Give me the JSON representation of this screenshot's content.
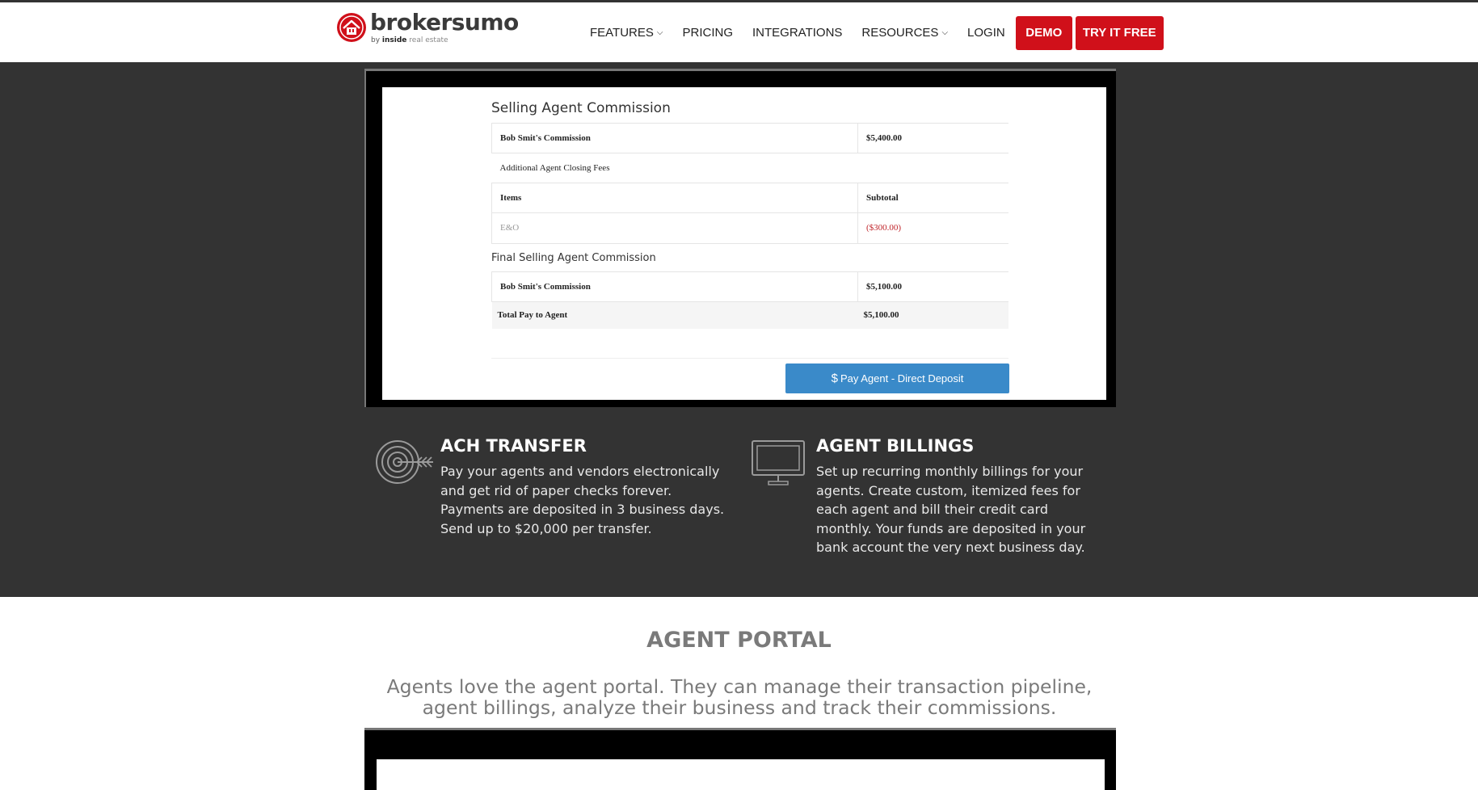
{
  "brand": {
    "name": "brokersumo",
    "by": "by",
    "sub_bold": "inside",
    "sub_rest": "real estate",
    "color": "#d0101a"
  },
  "nav": {
    "features": "FEATURES",
    "pricing": "PRICING",
    "integrations": "INTEGRATIONS",
    "resources": "RESOURCES",
    "login": "LOGIN",
    "demo": "DEMO",
    "try_free": "TRY IT FREE"
  },
  "commission": {
    "title": "Selling Agent Commission",
    "agent_commission_label": "Bob Smit's Commission",
    "agent_commission_value": "$5,400.00",
    "closing_fees_label": "Additional Agent Closing Fees",
    "items_header": "Items",
    "subtotal_header": "Subtotal",
    "fee_item": "E&O",
    "fee_value": "($300.00)",
    "final_heading": "Final Selling Agent Commission",
    "final_commission_label": "Bob Smit's Commission",
    "final_commission_value": "$5,100.00",
    "total_label": "Total Pay to Agent",
    "total_value": "$5,100.00",
    "pay_button": "Pay Agent - Direct Deposit",
    "pay_button_color": "#3a8ac9"
  },
  "features": [
    {
      "icon": "target-icon",
      "title": "ACH TRANSFER",
      "text": "Pay your agents and vendors electronically and get rid of paper checks forever. Payments are deposited in 3 business days. Send up to $20,000 per transfer."
    },
    {
      "icon": "monitor-icon",
      "title": "AGENT BILLINGS",
      "text": "Set up recurring monthly billings for your agents. Create custom, itemized fees for each agent and bill their credit card monthly. Your funds are deposited in your bank account the very next business day."
    }
  ],
  "portal": {
    "title": "AGENT PORTAL",
    "text": "Agents love the agent portal. They can manage their transaction pipeline, agent billings, analyze their business and track their commissions."
  }
}
